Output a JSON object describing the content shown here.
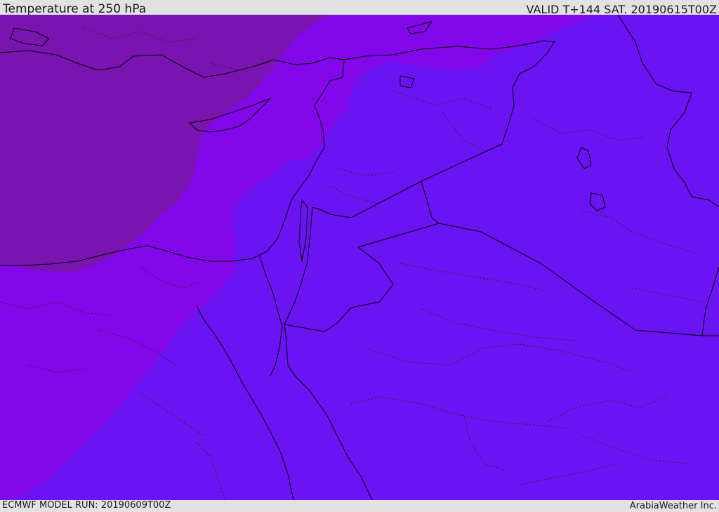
{
  "header": {
    "title": "Temperature at 250 hPa",
    "valid": "VALID T+144 SAT. 20190615T00Z"
  },
  "footer": {
    "model_run": "ECMWF MODEL RUN: 20190609T00Z",
    "credit": "ArabiaWeather Inc."
  },
  "map": {
    "field": "temperature-250hPa",
    "colors": {
      "zone_coldest": "#7a14b0",
      "zone_cold": "#8208ea",
      "zone_mild": "#6a14f4",
      "border_line": "#000000",
      "admin_line": "#222222"
    }
  }
}
